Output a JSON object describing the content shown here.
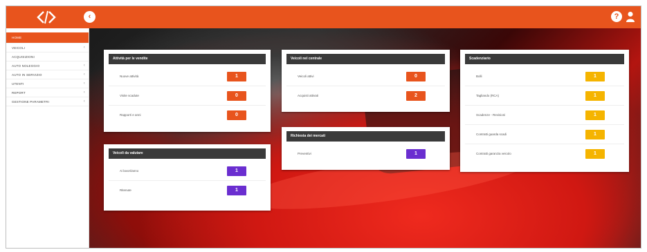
{
  "header": {
    "logo": "<>",
    "collapse_icon": "chevron-left-icon",
    "help_icon": "help-icon",
    "user_icon": "user-icon"
  },
  "sidebar": {
    "items": [
      {
        "label": "HOME",
        "active": true
      },
      {
        "label": "VEICOLI",
        "chevron": "‹"
      },
      {
        "label": "ACQUISIZIONI"
      },
      {
        "label": "AUTO NOLEGGIO",
        "chevron": "‹"
      },
      {
        "label": "AUTO IN SERVIZIO",
        "chevron": "‹"
      },
      {
        "label": "UTENTI",
        "chevron": "‹"
      },
      {
        "label": "REPORT",
        "chevron": "‹"
      },
      {
        "label": "GESTIONE PARAMETRI",
        "chevron": "‹"
      }
    ]
  },
  "panels": {
    "p1": {
      "title": "Attività per le vendite",
      "rows": [
        {
          "label": "Nuove attività",
          "value": "1"
        },
        {
          "label": "Visite scadute",
          "value": "0"
        },
        {
          "label": "Rapporti e anni",
          "value": "0"
        }
      ]
    },
    "p2": {
      "title": "Veicoli da valutare",
      "rows": [
        {
          "label": "Ai lavori/anno",
          "value": "1"
        },
        {
          "label": "Ritenute",
          "value": "1"
        }
      ]
    },
    "p3": {
      "title": "Veicoli nel centrale",
      "rows": [
        {
          "label": "Veicoli attivi",
          "value": "0"
        },
        {
          "label": "Acquisti attivati",
          "value": "2"
        }
      ]
    },
    "p4": {
      "title": "Richiesta dei mercati",
      "rows": [
        {
          "label": "Preventivi",
          "value": "1"
        }
      ]
    },
    "p5": {
      "title": "Scadenziario",
      "rows": [
        {
          "label": "Bolli",
          "value": "1"
        },
        {
          "label": "Tagliando (RCA)",
          "value": "1"
        },
        {
          "label": "Scadenze - Revisioni",
          "value": "1"
        },
        {
          "label": "Contratti guarda scadi",
          "value": "1"
        },
        {
          "label": "Contratti garanzia veicolo",
          "value": "1"
        }
      ]
    }
  },
  "colors": {
    "accent": "#e8541d",
    "badge_red": "#e8541d",
    "badge_purple": "#6a2ed0",
    "badge_yellow": "#f5b400",
    "panel_header": "#3a3a3a"
  }
}
